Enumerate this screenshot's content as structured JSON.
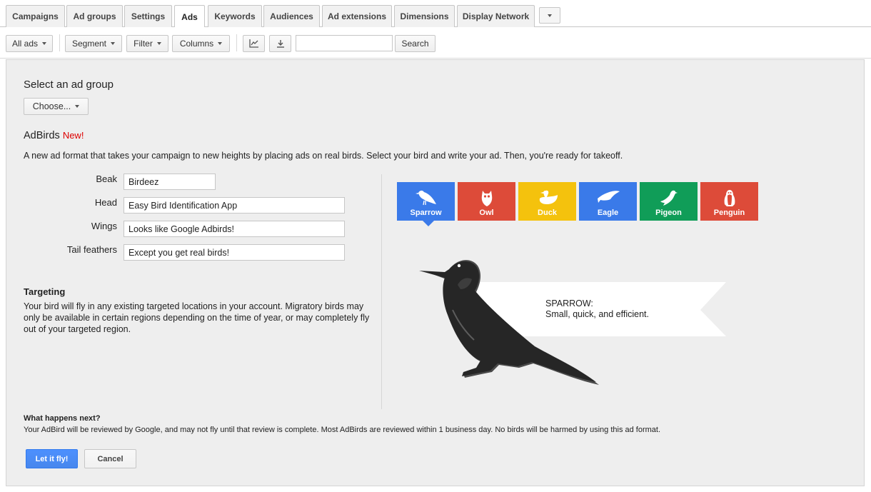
{
  "tabs": [
    {
      "label": "Campaigns"
    },
    {
      "label": "Ad groups"
    },
    {
      "label": "Settings"
    },
    {
      "label": "Ads"
    },
    {
      "label": "Keywords"
    },
    {
      "label": "Audiences"
    },
    {
      "label": "Ad extensions"
    },
    {
      "label": "Dimensions"
    },
    {
      "label": "Display Network"
    }
  ],
  "active_tab": "Ads",
  "toolbar": {
    "all_ads": "All ads",
    "segment": "Segment",
    "filter": "Filter",
    "columns": "Columns",
    "search_value": "",
    "search_button": "Search"
  },
  "form": {
    "select_heading": "Select an ad group",
    "choose_label": "Choose...",
    "title": "AdBirds",
    "new_badge": "New!",
    "description": "A new ad format that takes your campaign to new heights by placing ads on real birds. Select your bird and write your ad. Then, you're ready for takeoff.",
    "fields": [
      {
        "label": "Beak",
        "value": "Birdeez"
      },
      {
        "label": "Head",
        "value": "Easy Bird Identification App"
      },
      {
        "label": "Wings",
        "value": "Looks like Google Adbirds!"
      },
      {
        "label": "Tail feathers",
        "value": "Except you get real birds!"
      }
    ],
    "targeting_title": "Targeting",
    "targeting_text": "Your bird will fly in any existing targeted locations in your account. Migratory birds may only be available in certain regions depending on the time of year, or may completely fly out of your targeted region.",
    "next_title": "What happens next?",
    "next_text": "Your AdBird will be reviewed by Google, and may not fly until that review is complete. Most AdBirds are reviewed within 1 business day. No birds will be harmed by using this ad format.",
    "submit_label": "Let it fly!",
    "cancel_label": "Cancel"
  },
  "birds": [
    {
      "name": "Sparrow",
      "color": "#3a7ae9",
      "icon": "sparrow-icon"
    },
    {
      "name": "Owl",
      "color": "#dd4b39",
      "icon": "owl-icon"
    },
    {
      "name": "Duck",
      "color": "#f4c20d",
      "icon": "duck-icon"
    },
    {
      "name": "Eagle",
      "color": "#3a7ae9",
      "icon": "eagle-icon"
    },
    {
      "name": "Pigeon",
      "color": "#109d58",
      "icon": "pigeon-icon"
    },
    {
      "name": "Penguin",
      "color": "#dd4b39",
      "icon": "penguin-icon"
    }
  ],
  "selected_bird": {
    "title": "SPARROW:",
    "caption": "Small, quick, and efficient."
  }
}
